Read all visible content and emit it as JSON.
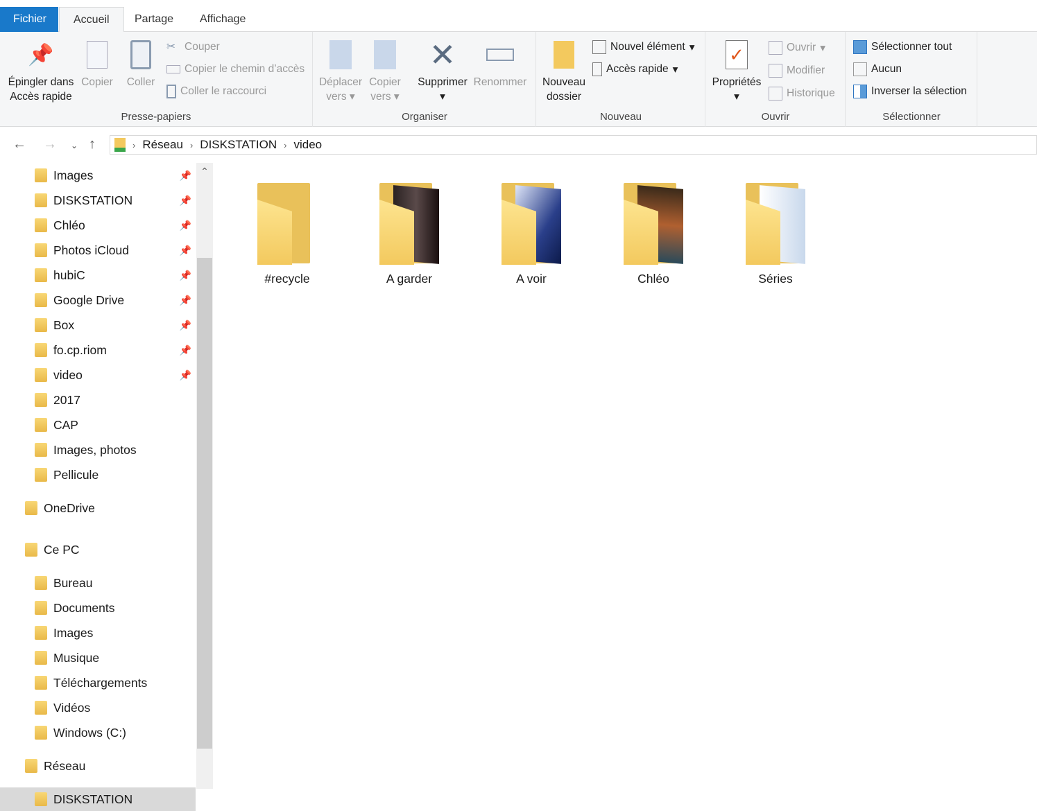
{
  "tabs": {
    "file": "Fichier",
    "home": "Accueil",
    "share": "Partage",
    "view": "Affichage"
  },
  "ribbon": {
    "clipboard": {
      "label": "Presse-papiers",
      "pin": "Épingler dans",
      "pin2": "Accès rapide",
      "copy": "Copier",
      "paste": "Coller",
      "cut": "Couper",
      "copy_path": "Copier le chemin d’accès",
      "paste_shortcut": "Coller le raccourci"
    },
    "organize": {
      "label": "Organiser",
      "move": "Déplacer",
      "move2": "vers",
      "copy": "Copier",
      "copy2": "vers",
      "delete": "Supprimer",
      "rename": "Renommer"
    },
    "new": {
      "label": "Nouveau",
      "new_folder": "Nouveau",
      "new_folder2": "dossier",
      "new_item": "Nouvel élément",
      "easy_access": "Accès rapide"
    },
    "open": {
      "label": "Ouvrir",
      "properties": "Propriétés",
      "open": "Ouvrir",
      "edit": "Modifier",
      "history": "Historique"
    },
    "select": {
      "label": "Sélectionner",
      "all": "Sélectionner tout",
      "none": "Aucun",
      "invert": "Inverser la sélection"
    }
  },
  "path": [
    "Réseau",
    "DISKSTATION",
    "video"
  ],
  "sidebar": [
    {
      "label": "Images",
      "pin": true
    },
    {
      "label": "DISKSTATION",
      "pin": true
    },
    {
      "label": "Chléo",
      "pin": true
    },
    {
      "label": "Photos iCloud",
      "pin": true
    },
    {
      "label": "hubiC",
      "pin": true
    },
    {
      "label": "Google Drive",
      "pin": true
    },
    {
      "label": "Box",
      "pin": true
    },
    {
      "label": "fo.cp.riom",
      "pin": true
    },
    {
      "label": "video",
      "pin": true
    },
    {
      "label": "2017"
    },
    {
      "label": "CAP"
    },
    {
      "label": "Images, photos"
    },
    {
      "label": "Pellicule"
    },
    {
      "label": "OneDrive",
      "top": true
    },
    {
      "label": "Ce PC",
      "top": true
    },
    {
      "label": "Bureau"
    },
    {
      "label": "Documents"
    },
    {
      "label": "Images"
    },
    {
      "label": "Musique"
    },
    {
      "label": "Téléchargements"
    },
    {
      "label": "Vidéos"
    },
    {
      "label": "Windows (C:)"
    },
    {
      "label": "Réseau",
      "top": true
    },
    {
      "label": "DISKSTATION",
      "selected": true
    }
  ],
  "folders": [
    {
      "name": "#recycle"
    },
    {
      "name": "A garder"
    },
    {
      "name": "A voir"
    },
    {
      "name": "Chléo"
    },
    {
      "name": "Séries"
    }
  ]
}
